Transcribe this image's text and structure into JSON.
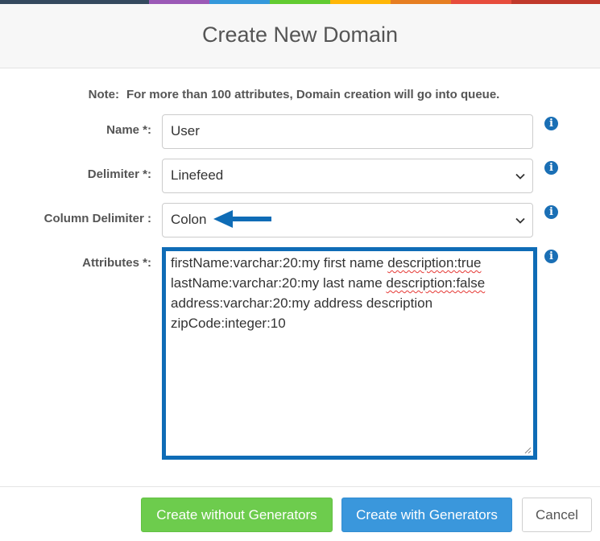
{
  "colors": {
    "top_stripes": [
      "#34495e",
      "#9b59b6",
      "#3498db",
      "#62cb31",
      "#ffb606",
      "#e67e22",
      "#e74c3c",
      "#c0392b"
    ],
    "accent_blue": "#0f6cb6",
    "info_icon": "#1a6fb5",
    "green_button": "#6dcc4d",
    "blue_button": "#3a97dc"
  },
  "dialog": {
    "title": "Create New Domain"
  },
  "note": {
    "label": "Note:",
    "text": "For more than 100 attributes, Domain creation will go into queue."
  },
  "form": {
    "name": {
      "label": "Name *:",
      "value": "User"
    },
    "delimiter": {
      "label": "Delimiter *:",
      "value": "Linefeed"
    },
    "column_delimiter": {
      "label": "Column Delimiter :",
      "value": "Colon"
    },
    "attributes": {
      "label": "Attributes *:",
      "lines": [
        {
          "before": "firstName:varchar:20:my first name ",
          "flagged": "description:true"
        },
        {
          "before": "lastName:varchar:20:my last name ",
          "flagged": "description:false"
        },
        {
          "before": "address:varchar:20:my address description",
          "flagged": ""
        },
        {
          "before": "zipCode:integer:10",
          "flagged": ""
        }
      ]
    },
    "info_icon": "info-icon",
    "select_icon": "chevron-down-icon"
  },
  "buttons": {
    "create_without_generators": "Create without Generators",
    "create_with_generators": "Create with Generators",
    "cancel": "Cancel"
  }
}
